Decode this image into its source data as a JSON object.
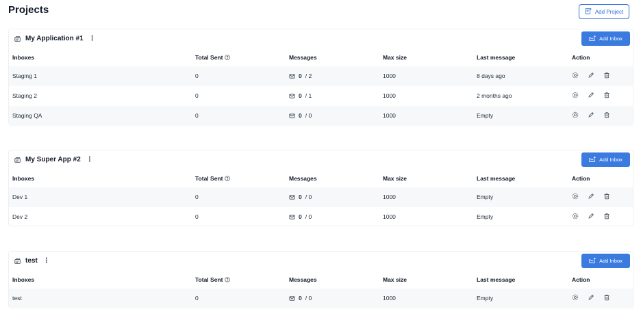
{
  "page": {
    "title": "Projects",
    "add_project_label": "Add Project"
  },
  "columns": {
    "inboxes": "Inboxes",
    "total_sent": "Total Sent",
    "messages": "Messages",
    "max_size": "Max size",
    "last_message": "Last message",
    "action": "Action"
  },
  "icons": {
    "folder": "folder-icon",
    "kebab": "kebab-menu-icon",
    "add_inbox": "add-inbox-icon",
    "add_project": "add-project-icon",
    "help": "help-circle-icon",
    "envelope": "envelope-icon",
    "settings": "gear-icon",
    "edit": "pencil-icon",
    "delete": "trash-icon"
  },
  "colors": {
    "accent": "#3b7be0",
    "link": "#2f6fd6",
    "row_shade": "#f7f8f9"
  },
  "projects": [
    {
      "name": "My Application #1",
      "kebab": "⋮",
      "add_inbox_label": "Add Inbox",
      "inboxes": [
        {
          "name": "Staging 1",
          "total_sent": "0",
          "messages_count": "0",
          "messages_max": "/ 2",
          "max_size": "1000",
          "last_message": "8 days ago"
        },
        {
          "name": "Staging 2",
          "total_sent": "0",
          "messages_count": "0",
          "messages_max": "/ 1",
          "max_size": "1000",
          "last_message": "2 months ago"
        },
        {
          "name": "Staging QA",
          "total_sent": "0",
          "messages_count": "0",
          "messages_max": "/ 0",
          "max_size": "1000",
          "last_message": "Empty"
        }
      ]
    },
    {
      "name": "My Super App #2",
      "kebab": "⋮",
      "add_inbox_label": "Add Inbox",
      "inboxes": [
        {
          "name": "Dev 1",
          "total_sent": "0",
          "messages_count": "0",
          "messages_max": "/ 0",
          "max_size": "1000",
          "last_message": "Empty"
        },
        {
          "name": "Dev 2",
          "total_sent": "0",
          "messages_count": "0",
          "messages_max": "/ 0",
          "max_size": "1000",
          "last_message": "Empty"
        }
      ]
    },
    {
      "name": "test",
      "kebab": "⋮",
      "add_inbox_label": "Add Inbox",
      "inboxes": [
        {
          "name": "test",
          "total_sent": "0",
          "messages_count": "0",
          "messages_max": "/ 0",
          "max_size": "1000",
          "last_message": "Empty"
        }
      ]
    }
  ]
}
